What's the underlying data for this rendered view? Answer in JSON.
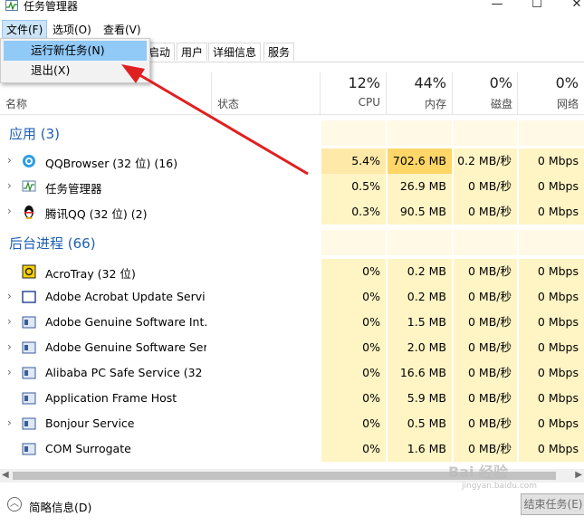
{
  "window": {
    "title": "任务管理器",
    "minimize_glyph": "—",
    "maximize_glyph": "☐",
    "close_glyph": "✕"
  },
  "menu": {
    "file": "文件(F)",
    "options": "选项(O)",
    "view": "查看(V)",
    "dropdown": [
      "运行新任务(N)",
      "退出(X)"
    ]
  },
  "tabs": [
    "启动",
    "用户",
    "详细信息",
    "服务"
  ],
  "columns": {
    "name": "名称",
    "status": "状态",
    "cpu_pct": "12%",
    "cpu": "CPU",
    "mem_pct": "44%",
    "mem": "内存",
    "disk_pct": "0%",
    "disk": "磁盘",
    "net_pct": "0%",
    "net": "网络"
  },
  "groups": {
    "apps": "应用 (3)",
    "background": "后台进程 (66)"
  },
  "apps": [
    {
      "name": "QQBrowser (32 位) (16)",
      "icon": "qqbrowser-icon",
      "cpu": "5.4%",
      "mem": "702.6 MB",
      "disk": "0.2 MB/秒",
      "net": "0 Mbps"
    },
    {
      "name": "任务管理器",
      "icon": "task-manager-icon",
      "cpu": "0.5%",
      "mem": "26.9 MB",
      "disk": "0 MB/秒",
      "net": "0 Mbps"
    },
    {
      "name": "腾讯QQ (32 位) (2)",
      "icon": "qq-penguin-icon",
      "cpu": "0.3%",
      "mem": "90.5 MB",
      "disk": "0 MB/秒",
      "net": "0 Mbps"
    }
  ],
  "background": [
    {
      "name": "AcroTray (32 位)",
      "icon": "acrotray-icon",
      "cpu": "0%",
      "mem": "0.2 MB",
      "disk": "0 MB/秒",
      "net": "0 Mbps"
    },
    {
      "name": "Adobe Acrobat Update Servi...",
      "icon": "service-window-icon",
      "cpu": "0%",
      "mem": "0.2 MB",
      "disk": "0 MB/秒",
      "net": "0 Mbps"
    },
    {
      "name": "Adobe Genuine Software Int...",
      "icon": "service-window-icon",
      "cpu": "0%",
      "mem": "1.5 MB",
      "disk": "0 MB/秒",
      "net": "0 Mbps"
    },
    {
      "name": "Adobe Genuine Software Ser...",
      "icon": "service-window-icon",
      "cpu": "0%",
      "mem": "2.0 MB",
      "disk": "0 MB/秒",
      "net": "0 Mbps"
    },
    {
      "name": "Alibaba PC Safe Service (32 ...",
      "icon": "service-window-icon",
      "cpu": "0%",
      "mem": "16.6 MB",
      "disk": "0 MB/秒",
      "net": "0 Mbps"
    },
    {
      "name": "Application Frame Host",
      "icon": "service-window-icon",
      "cpu": "0%",
      "mem": "5.9 MB",
      "disk": "0 MB/秒",
      "net": "0 Mbps"
    },
    {
      "name": "Bonjour Service",
      "icon": "service-window-icon",
      "cpu": "0%",
      "mem": "0.5 MB",
      "disk": "0 MB/秒",
      "net": "0 Mbps"
    },
    {
      "name": "COM Surrogate",
      "icon": "service-window-icon",
      "cpu": "0%",
      "mem": "1.6 MB",
      "disk": "0 MB/秒",
      "net": "0 Mbps"
    }
  ],
  "footer": {
    "fewer_details": "简略信息(D)",
    "end_task": "结束任务(E)"
  },
  "watermark": {
    "brand": "Bai 经验",
    "url": "jingyan.baidu.com"
  },
  "colors": {
    "group_title": "#1e5fb5",
    "heat_strong": "#ffd667",
    "heat_light": "#fff4c4",
    "menu_highlight": "#91c9f7",
    "annotation_arrow": "#e02020"
  }
}
